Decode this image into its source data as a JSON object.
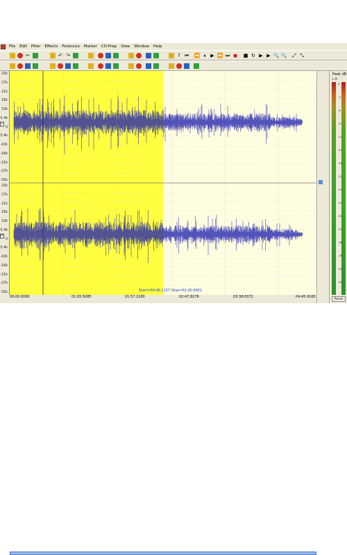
{
  "menu": [
    "File",
    "Edit",
    "Filter",
    "Effects",
    "Forensics",
    "Marker",
    "CD-Prep",
    "View",
    "Window",
    "Help"
  ],
  "toolbar1_icons": [
    "new-file",
    "open-file",
    "save-file",
    "cut",
    "copy",
    "paste",
    "delete",
    "undo",
    "redo",
    "print",
    "properties",
    "trim",
    "zoom-select",
    "mark-in",
    "mark-out",
    "filter-a",
    "filter-b",
    "filter-c",
    "effect-a",
    "effect-b",
    "marker",
    "cd",
    "help",
    "go-start",
    "rewind",
    "pause",
    "play",
    "fast-forward",
    "go-end",
    "record",
    "stop-record",
    "loop",
    "play-selection",
    "play-to-end",
    "zoom-in",
    "zoom-out",
    "zoom-fit",
    "zoom-all"
  ],
  "toolbar2_icons": [
    "select-tool",
    "envelope",
    "normalize",
    "fade-in",
    "fade-out",
    "amplify",
    "silence",
    "insert",
    "eq-1",
    "eq-2",
    "eq-3",
    "eq-4",
    "noise-reduce",
    "declick",
    "spectrum",
    "stereo",
    "mono",
    "invert",
    "reverse",
    "pitch",
    "tempo",
    "resample",
    "dc-offset",
    "channel-1",
    "channel-2",
    "channel-3"
  ],
  "y_axis": {
    "labels": [
      "32k",
      "27k",
      "21k",
      "16k",
      "10k",
      "5.4k",
      "0",
      "-5.4k",
      "-10k",
      "-16k",
      "-21k",
      "-27k",
      "-32k"
    ],
    "channel_markers": [
      "L",
      "R"
    ]
  },
  "timeline": {
    "labels": [
      "00:00.0000",
      "01:05.5085",
      "01:57.2180",
      "02:47.8276",
      "03:38.6372",
      "04:45.9165"
    ]
  },
  "selection_info": "Start=00:06.1157  Stop=02:30.0001",
  "selection": {
    "start_fraction": 0.0,
    "end_fraction": 0.5
  },
  "colors": {
    "waveform": "#1a1ab0",
    "selection_bg": "#ffff40",
    "unselected_bg": "#fffde0",
    "grid": "#c8c8c8"
  },
  "meter": {
    "title": "Peak dB",
    "header": "L  R",
    "ticks": [
      "0",
      "-3",
      "-6",
      "-9",
      "-12",
      "-15",
      "-18",
      "-21",
      "-24",
      "-27",
      "-30",
      "-33",
      "-36",
      "-39",
      "-42",
      "-45"
    ],
    "reset_label": "Reset"
  }
}
